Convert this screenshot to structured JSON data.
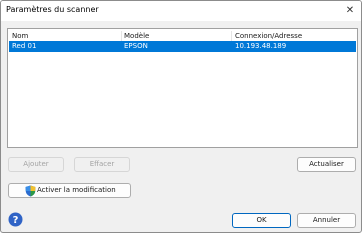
{
  "window": {
    "title": "Paramètres du scanner",
    "close_glyph": "✕"
  },
  "list": {
    "columns": [
      "Nom",
      "Modèle",
      "Connexion/Adresse"
    ],
    "rows": [
      {
        "name": "Red 01",
        "model": "EPSON",
        "address": "10.193.48.189"
      }
    ]
  },
  "buttons": {
    "add": "Ajouter",
    "delete": "Effacer",
    "update": "Actualiser",
    "activate": "Activer la modification",
    "ok": "OK",
    "cancel": "Annuler"
  },
  "icons": {
    "shield": "uac-shield-icon",
    "help": "help-icon"
  },
  "colors": {
    "selection": "#0078d7",
    "ok_border": "#0067c0"
  }
}
